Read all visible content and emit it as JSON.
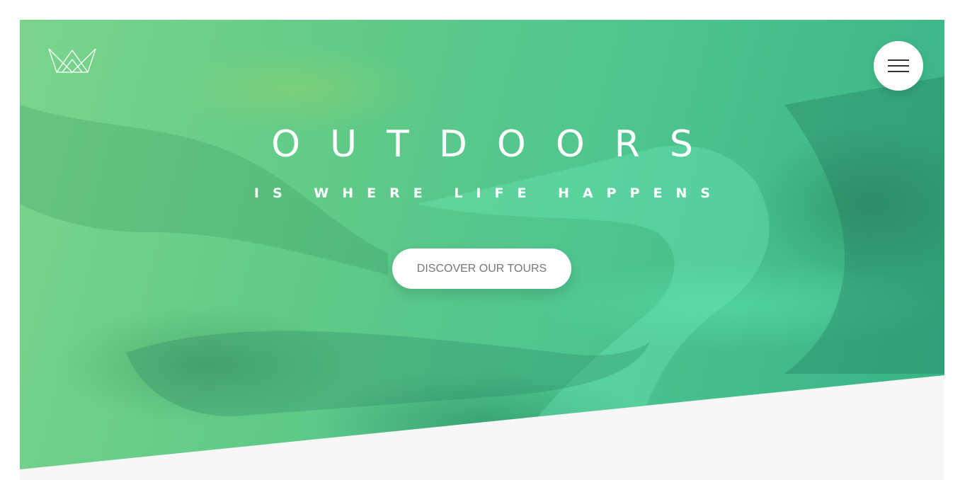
{
  "header": {
    "logo_icon": "crown-logo-icon",
    "menu_icon": "hamburger-menu-icon"
  },
  "hero": {
    "title": "OUTDOORS",
    "subtitle": "IS WHERE LIFE HAPPENS",
    "cta_label": "DISCOVER OUR TOURS"
  },
  "colors": {
    "hero_overlay_light": "#7bd48c",
    "hero_overlay_dark": "#37b387",
    "page_background": "#f7f7f7",
    "button_text": "#777777"
  }
}
